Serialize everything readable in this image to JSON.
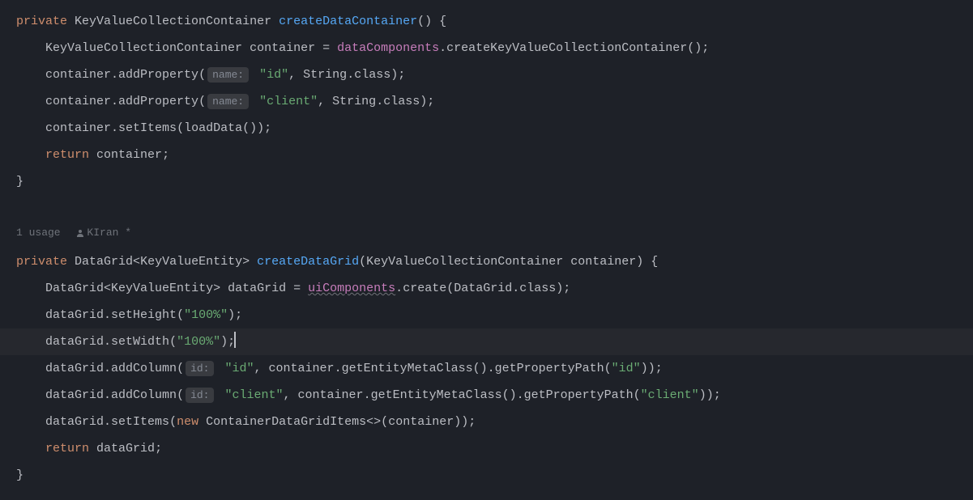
{
  "method1": {
    "modifier": "private",
    "returnType": "KeyValueCollectionContainer",
    "name": "createDataContainer",
    "line1": {
      "type": "KeyValueCollectionContainer",
      "var": "container",
      "field": "dataComponents",
      "call": "createKeyValueCollectionContainer"
    },
    "line2": {
      "obj": "container",
      "call": "addProperty",
      "hint": "name:",
      "arg1": "\"id\"",
      "arg2type": "String",
      "arg2suffix": ".class"
    },
    "line3": {
      "obj": "container",
      "call": "addProperty",
      "hint": "name:",
      "arg1": "\"client\"",
      "arg2type": "String",
      "arg2suffix": ".class"
    },
    "line4": {
      "obj": "container",
      "call": "setItems",
      "inner": "loadData"
    },
    "line5": {
      "kw": "return",
      "var": "container"
    }
  },
  "usage": {
    "usages": "1 usage",
    "author": "KIran *"
  },
  "method2": {
    "modifier": "private",
    "returnType": "DataGrid",
    "generic": "KeyValueEntity",
    "name": "createDataGrid",
    "paramType": "KeyValueCollectionContainer",
    "paramName": "container",
    "body": {
      "l1": {
        "type": "DataGrid",
        "generic": "KeyValueEntity",
        "var": "dataGrid",
        "field": "uiComponents",
        "call": "create",
        "argType": "DataGrid",
        "argSuffix": ".class"
      },
      "l2": {
        "obj": "dataGrid",
        "call": "setHeight",
        "arg": "\"100%\""
      },
      "l3": {
        "obj": "dataGrid",
        "call": "setWidth",
        "arg": "\"100%\""
      },
      "l4": {
        "obj": "dataGrid",
        "call": "addColumn",
        "hint": "id:",
        "arg1": "\"id\"",
        "chain1": "container",
        "chain2": "getEntityMetaClass",
        "chain3": "getPropertyPath",
        "chainArg": "\"id\""
      },
      "l5": {
        "obj": "dataGrid",
        "call": "addColumn",
        "hint": "id:",
        "arg1": "\"client\"",
        "chain1": "container",
        "chain2": "getEntityMetaClass",
        "chain3": "getPropertyPath",
        "chainArg": "\"client\""
      },
      "l6": {
        "obj": "dataGrid",
        "call": "setItems",
        "kw": "new",
        "ctor": "ContainerDataGridItems",
        "diamond": "<>",
        "arg": "container"
      },
      "l7": {
        "kw": "return",
        "var": "dataGrid"
      }
    }
  }
}
